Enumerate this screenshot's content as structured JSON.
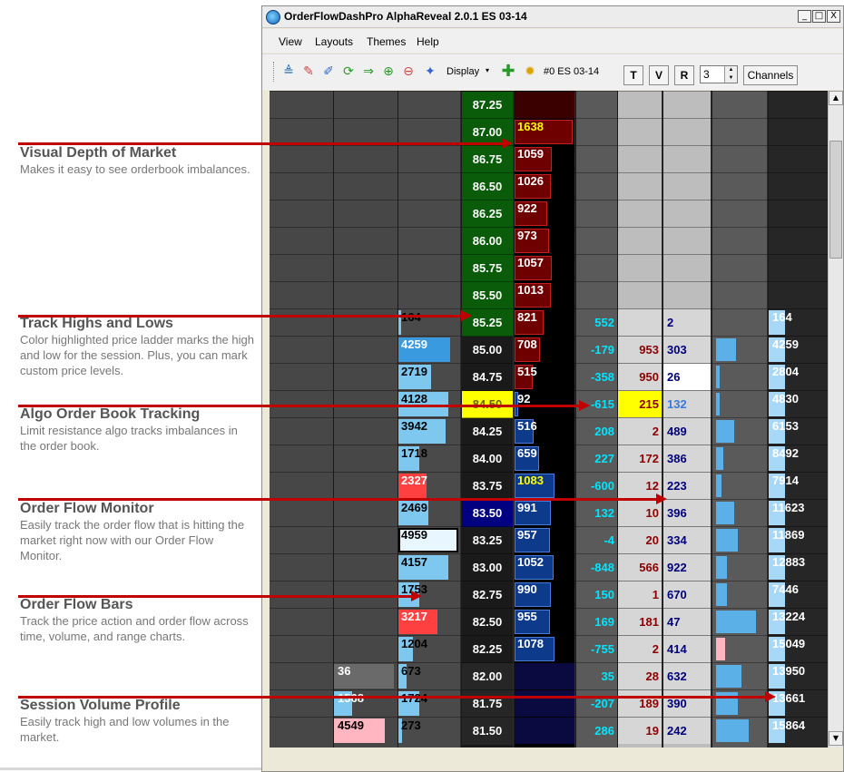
{
  "window": {
    "title": "OrderFlowDashPro AlphaReveal 2.0.1 ES 03-14",
    "min_label": "_",
    "max_label": "□",
    "close_label": "X"
  },
  "menu": [
    "View",
    "Layouts",
    "Themes",
    "Help"
  ],
  "toolbar": {
    "display_label": "Display",
    "instrument_label": "#0  ES 03-14",
    "t_label": "T",
    "v_label": "V",
    "r_label": "R",
    "spin_value": "3",
    "channels_label": "Channels"
  },
  "callouts": [
    {
      "title": "Visual Depth of Market",
      "text": "Makes it easy to see orderbook imbalances."
    },
    {
      "title": "Track Highs and Lows",
      "text": "Color highlighted price ladder marks the high and low for the session. Plus, you can mark custom price levels."
    },
    {
      "title": "Algo Order Book Tracking",
      "text": "Limit resistance algo tracks imbalances in the order book."
    },
    {
      "title": "Order Flow Monitor",
      "text": "Easily track the order flow that is hitting the market right now with our Order Flow Monitor."
    },
    {
      "title": "Order Flow Bars",
      "text": "Track the price action and order flow across time, volume, and range charts."
    },
    {
      "title": "Session Volume Profile",
      "text": "Easily track high and low volumes in the market."
    }
  ],
  "ladder": {
    "rows": [
      {
        "price": "87.25",
        "ask": "",
        "bid": "",
        "delta": "",
        "buy": "",
        "sell": "",
        "vp": "",
        "profile": ""
      },
      {
        "price": "87.00",
        "ask": "1638",
        "bid": "",
        "delta": "",
        "buy": "",
        "sell": "",
        "vp": "",
        "profile": ""
      },
      {
        "price": "86.75",
        "ask": "1059",
        "bid": "",
        "delta": "",
        "buy": "",
        "sell": "",
        "vp": "",
        "profile": ""
      },
      {
        "price": "86.50",
        "ask": "1026",
        "bid": "",
        "delta": "",
        "buy": "",
        "sell": "",
        "vp": "",
        "profile": ""
      },
      {
        "price": "86.25",
        "ask": "922",
        "bid": "",
        "delta": "",
        "buy": "",
        "sell": "",
        "vp": "",
        "profile": ""
      },
      {
        "price": "86.00",
        "ask": "973",
        "bid": "",
        "delta": "",
        "buy": "",
        "sell": "",
        "vp": "",
        "profile": ""
      },
      {
        "price": "85.75",
        "ask": "1057",
        "bid": "",
        "delta": "",
        "buy": "",
        "sell": "",
        "vp": "",
        "profile": ""
      },
      {
        "price": "85.50",
        "ask": "1013",
        "bid": "",
        "delta": "",
        "buy": "",
        "sell": "",
        "vp": "",
        "profile": ""
      },
      {
        "price": "85.25",
        "ask": "821",
        "bid": "",
        "delta": "552",
        "buy": "",
        "sell": "2",
        "vp": "164",
        "profile": "164"
      },
      {
        "price": "85.00",
        "ask": "708",
        "bid": "",
        "delta": "-179",
        "buy": "953",
        "sell": "303",
        "vp": "4259",
        "profile": "4259"
      },
      {
        "price": "84.75",
        "ask": "515",
        "bid": "",
        "delta": "-358",
        "buy": "950",
        "sell": "26",
        "vp": "2719",
        "profile": "2804"
      },
      {
        "price": "84.50",
        "ask": "",
        "bid": "92",
        "delta": "-615",
        "buy": "215",
        "sell": "132",
        "vp": "4128",
        "profile": "4830"
      },
      {
        "price": "84.25",
        "ask": "",
        "bid": "516",
        "delta": "208",
        "buy": "2",
        "sell": "489",
        "vp": "3942",
        "profile": "6153"
      },
      {
        "price": "84.00",
        "ask": "",
        "bid": "659",
        "delta": "227",
        "buy": "172",
        "sell": "386",
        "vp": "1718",
        "profile": "8492"
      },
      {
        "price": "83.75",
        "ask": "",
        "bid": "1083",
        "delta": "-600",
        "buy": "12",
        "sell": "223",
        "vp": "2327",
        "profile": "7914"
      },
      {
        "price": "83.50",
        "ask": "",
        "bid": "991",
        "delta": "132",
        "buy": "10",
        "sell": "396",
        "vp": "2469",
        "profile": "11623"
      },
      {
        "price": "83.25",
        "ask": "",
        "bid": "957",
        "delta": "-4",
        "buy": "20",
        "sell": "334",
        "vp": "4959",
        "profile": "11869"
      },
      {
        "price": "83.00",
        "ask": "",
        "bid": "1052",
        "delta": "-848",
        "buy": "566",
        "sell": "922",
        "vp": "4157",
        "profile": "12883"
      },
      {
        "price": "82.75",
        "ask": "",
        "bid": "990",
        "delta": "150",
        "buy": "1",
        "sell": "670",
        "vp": "1753",
        "profile": "7446"
      },
      {
        "price": "82.50",
        "ask": "",
        "bid": "955",
        "delta": "169",
        "buy": "181",
        "sell": "47",
        "vp": "3217",
        "profile": "13224"
      },
      {
        "price": "82.25",
        "ask": "",
        "bid": "1078",
        "delta": "-755",
        "buy": "2",
        "sell": "414",
        "vp": "1204",
        "profile": "15049"
      },
      {
        "price": "82.00",
        "ask": "",
        "bid": "",
        "delta": "35",
        "buy": "28",
        "sell": "632",
        "vp": "673",
        "profile": "13950"
      },
      {
        "price": "81.75",
        "ask": "",
        "bid": "",
        "delta": "-207",
        "buy": "189",
        "sell": "390",
        "vp": "1724",
        "profile": "13661"
      },
      {
        "price": "81.50",
        "ask": "",
        "bid": "",
        "delta": "286",
        "buy": "19",
        "sell": "242",
        "vp": "273",
        "profile": "15864"
      }
    ],
    "bars_col": [
      {
        "row": 21,
        "value": "36"
      },
      {
        "row": 22,
        "value": "1568"
      },
      {
        "row": 23,
        "value": "4549"
      }
    ]
  },
  "colors": {
    "accent_red": "#c00000",
    "price_green": "#0a5c0a",
    "ask_red": "#6e0000",
    "bid_blue": "#0d3a8a",
    "highlight_yellow": "#ffff00"
  }
}
